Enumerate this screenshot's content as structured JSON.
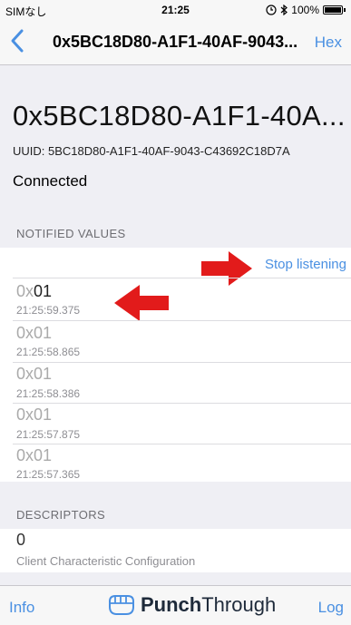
{
  "status_bar": {
    "carrier": "SIMなし",
    "time": "21:25",
    "battery_text": "100%"
  },
  "nav": {
    "title": "0x5BC18D80-A1F1-40AF-9043...",
    "hex_label": "Hex"
  },
  "characteristic": {
    "name": "0x5BC18D80-A1F1-40A...",
    "uuid": "UUID: 5BC18D80-A1F1-40AF-9043-C43692C18D7A",
    "status": "Connected"
  },
  "notified": {
    "section_title": "NOTIFIED VALUES",
    "stop_label": "Stop listening",
    "values": [
      {
        "prefix": "0x",
        "value": "01",
        "time": "21:25:59.375"
      },
      {
        "prefix": "0x",
        "value": "01",
        "time": "21:25:58.865"
      },
      {
        "prefix": "0x",
        "value": "01",
        "time": "21:25:58.386"
      },
      {
        "prefix": "0x",
        "value": "01",
        "time": "21:25:57.875"
      },
      {
        "prefix": "0x",
        "value": "01",
        "time": "21:25:57.365"
      }
    ]
  },
  "descriptors": {
    "section_title": "DESCRIPTORS",
    "items": [
      {
        "value": "0",
        "name": "Client Characteristic Configuration"
      }
    ]
  },
  "tab_bar": {
    "info_label": "Info",
    "brand_bold": "Punch",
    "brand_regular": "Through",
    "log_label": "Log"
  },
  "colors": {
    "accent": "#4a90e2",
    "arrow": "#e21b1b",
    "background": "#efeff4"
  },
  "icons": [
    "back-chevron-icon",
    "alarm-icon",
    "bluetooth-icon",
    "battery-icon",
    "punch-through-logo-icon",
    "red-arrow-icon"
  ]
}
